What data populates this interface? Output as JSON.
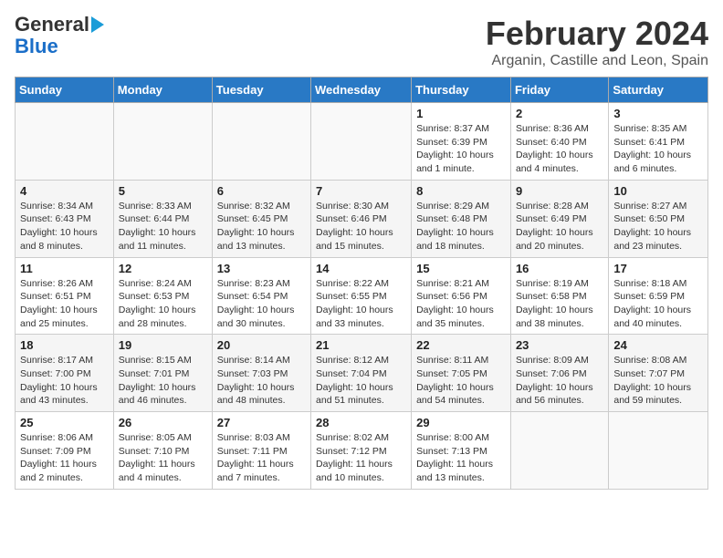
{
  "header": {
    "logo_line1": "General",
    "logo_line2": "Blue",
    "month": "February 2024",
    "location": "Arganin, Castille and Leon, Spain"
  },
  "columns": [
    "Sunday",
    "Monday",
    "Tuesday",
    "Wednesday",
    "Thursday",
    "Friday",
    "Saturday"
  ],
  "weeks": [
    [
      {
        "day": "",
        "detail": ""
      },
      {
        "day": "",
        "detail": ""
      },
      {
        "day": "",
        "detail": ""
      },
      {
        "day": "",
        "detail": ""
      },
      {
        "day": "1",
        "detail": "Sunrise: 8:37 AM\nSunset: 6:39 PM\nDaylight: 10 hours\nand 1 minute."
      },
      {
        "day": "2",
        "detail": "Sunrise: 8:36 AM\nSunset: 6:40 PM\nDaylight: 10 hours\nand 4 minutes."
      },
      {
        "day": "3",
        "detail": "Sunrise: 8:35 AM\nSunset: 6:41 PM\nDaylight: 10 hours\nand 6 minutes."
      }
    ],
    [
      {
        "day": "4",
        "detail": "Sunrise: 8:34 AM\nSunset: 6:43 PM\nDaylight: 10 hours\nand 8 minutes."
      },
      {
        "day": "5",
        "detail": "Sunrise: 8:33 AM\nSunset: 6:44 PM\nDaylight: 10 hours\nand 11 minutes."
      },
      {
        "day": "6",
        "detail": "Sunrise: 8:32 AM\nSunset: 6:45 PM\nDaylight: 10 hours\nand 13 minutes."
      },
      {
        "day": "7",
        "detail": "Sunrise: 8:30 AM\nSunset: 6:46 PM\nDaylight: 10 hours\nand 15 minutes."
      },
      {
        "day": "8",
        "detail": "Sunrise: 8:29 AM\nSunset: 6:48 PM\nDaylight: 10 hours\nand 18 minutes."
      },
      {
        "day": "9",
        "detail": "Sunrise: 8:28 AM\nSunset: 6:49 PM\nDaylight: 10 hours\nand 20 minutes."
      },
      {
        "day": "10",
        "detail": "Sunrise: 8:27 AM\nSunset: 6:50 PM\nDaylight: 10 hours\nand 23 minutes."
      }
    ],
    [
      {
        "day": "11",
        "detail": "Sunrise: 8:26 AM\nSunset: 6:51 PM\nDaylight: 10 hours\nand 25 minutes."
      },
      {
        "day": "12",
        "detail": "Sunrise: 8:24 AM\nSunset: 6:53 PM\nDaylight: 10 hours\nand 28 minutes."
      },
      {
        "day": "13",
        "detail": "Sunrise: 8:23 AM\nSunset: 6:54 PM\nDaylight: 10 hours\nand 30 minutes."
      },
      {
        "day": "14",
        "detail": "Sunrise: 8:22 AM\nSunset: 6:55 PM\nDaylight: 10 hours\nand 33 minutes."
      },
      {
        "day": "15",
        "detail": "Sunrise: 8:21 AM\nSunset: 6:56 PM\nDaylight: 10 hours\nand 35 minutes."
      },
      {
        "day": "16",
        "detail": "Sunrise: 8:19 AM\nSunset: 6:58 PM\nDaylight: 10 hours\nand 38 minutes."
      },
      {
        "day": "17",
        "detail": "Sunrise: 8:18 AM\nSunset: 6:59 PM\nDaylight: 10 hours\nand 40 minutes."
      }
    ],
    [
      {
        "day": "18",
        "detail": "Sunrise: 8:17 AM\nSunset: 7:00 PM\nDaylight: 10 hours\nand 43 minutes."
      },
      {
        "day": "19",
        "detail": "Sunrise: 8:15 AM\nSunset: 7:01 PM\nDaylight: 10 hours\nand 46 minutes."
      },
      {
        "day": "20",
        "detail": "Sunrise: 8:14 AM\nSunset: 7:03 PM\nDaylight: 10 hours\nand 48 minutes."
      },
      {
        "day": "21",
        "detail": "Sunrise: 8:12 AM\nSunset: 7:04 PM\nDaylight: 10 hours\nand 51 minutes."
      },
      {
        "day": "22",
        "detail": "Sunrise: 8:11 AM\nSunset: 7:05 PM\nDaylight: 10 hours\nand 54 minutes."
      },
      {
        "day": "23",
        "detail": "Sunrise: 8:09 AM\nSunset: 7:06 PM\nDaylight: 10 hours\nand 56 minutes."
      },
      {
        "day": "24",
        "detail": "Sunrise: 8:08 AM\nSunset: 7:07 PM\nDaylight: 10 hours\nand 59 minutes."
      }
    ],
    [
      {
        "day": "25",
        "detail": "Sunrise: 8:06 AM\nSunset: 7:09 PM\nDaylight: 11 hours\nand 2 minutes."
      },
      {
        "day": "26",
        "detail": "Sunrise: 8:05 AM\nSunset: 7:10 PM\nDaylight: 11 hours\nand 4 minutes."
      },
      {
        "day": "27",
        "detail": "Sunrise: 8:03 AM\nSunset: 7:11 PM\nDaylight: 11 hours\nand 7 minutes."
      },
      {
        "day": "28",
        "detail": "Sunrise: 8:02 AM\nSunset: 7:12 PM\nDaylight: 11 hours\nand 10 minutes."
      },
      {
        "day": "29",
        "detail": "Sunrise: 8:00 AM\nSunset: 7:13 PM\nDaylight: 11 hours\nand 13 minutes."
      },
      {
        "day": "",
        "detail": ""
      },
      {
        "day": "",
        "detail": ""
      }
    ]
  ]
}
